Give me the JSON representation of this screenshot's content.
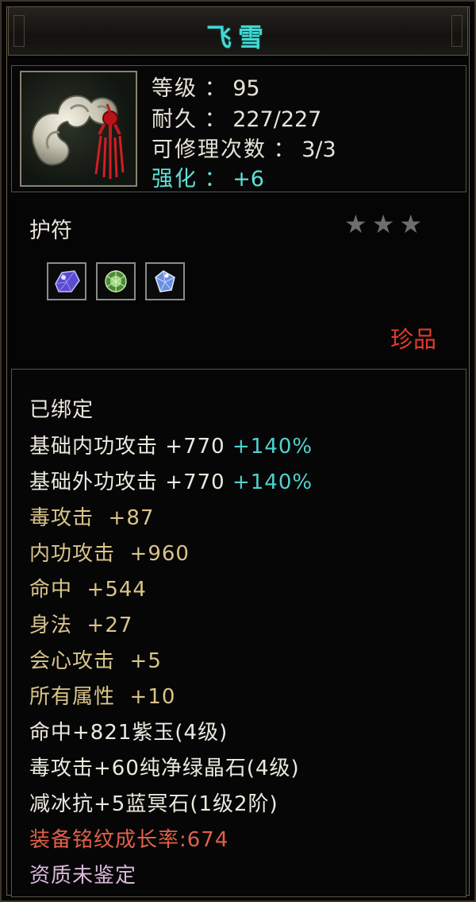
{
  "item": {
    "name": "飞雪",
    "level_label": "等级",
    "level_value": "95",
    "durability_label": "耐久",
    "durability_value": "227/227",
    "repair_label": "可修理次数",
    "repair_value": "3/3",
    "enhance_label": "强化",
    "enhance_value": "+6",
    "icon": "jade-amulet-icon",
    "type": "护符",
    "stars": 3,
    "gems": [
      "purple-jade-gem-icon",
      "green-crystal-gem-icon",
      "blue-stone-gem-icon"
    ],
    "rarity": "珍品"
  },
  "attributes": {
    "bound": "已绑定",
    "base_inner_attack": {
      "label": "基础内功攻击",
      "value": "+770",
      "bonus": "+140%"
    },
    "base_outer_attack": {
      "label": "基础外功攻击",
      "value": "+770",
      "bonus": "+140%"
    },
    "poison_attack": "毒攻击  +87",
    "inner_attack": "内功攻击  +960",
    "hit": "命中  +544",
    "agility": "身法  +27",
    "crit": "会心攻击  +5",
    "all_attributes": "所有属性  +10",
    "gem_1": "命中+821紫玉(4级)",
    "gem_2": "毒攻击+60纯净绿晶石(4级)",
    "gem_3": "减冰抗+5蓝冥石(1级2阶)",
    "growth": "装备铭纹成长率:674",
    "quality": "资质未鉴定"
  },
  "colors": {
    "title": "#41d8d2",
    "enhance": "#5fe0d8",
    "rarity": "#e03a2c",
    "gold_attr": "#d9c489",
    "growth": "#e0604a",
    "quality": "#d9b8d9"
  }
}
